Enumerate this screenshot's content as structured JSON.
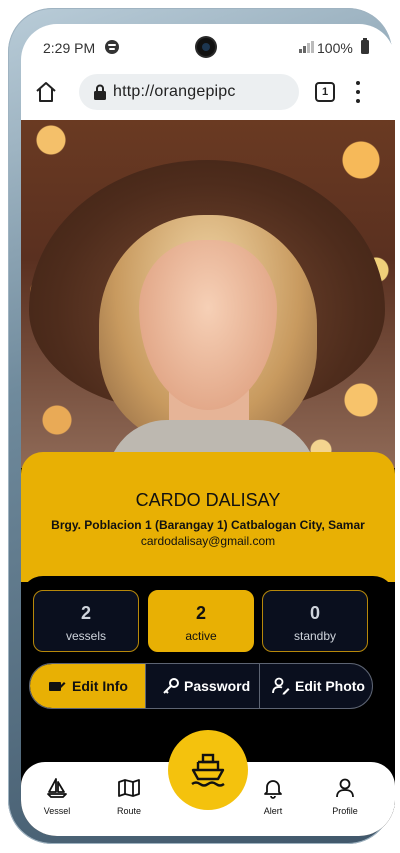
{
  "status_bar": {
    "time": "2:29 PM",
    "battery": "100%"
  },
  "browser": {
    "url": "http://orangepipc",
    "tab_count": "1"
  },
  "profile": {
    "name": "CARDO DALISAY",
    "address": "Brgy. Poblacion 1 (Barangay 1) Catbalogan City, Samar",
    "email": "cardodalisay@gmail.com"
  },
  "stats": [
    {
      "value": "2",
      "label": "vessels"
    },
    {
      "value": "2",
      "label": "active"
    },
    {
      "value": "0",
      "label": "standby"
    }
  ],
  "actions": {
    "edit_info": "Edit Info",
    "password": "Password",
    "edit_photo": "Edit Photo"
  },
  "nav": {
    "vessel": "Vessel",
    "route": "Route",
    "alert": "Alert",
    "profile": "Profile"
  },
  "colors": {
    "accent": "#e8b004",
    "fab": "#f4c20d",
    "panel": "#000000",
    "card_dark": "#0a0f1e"
  },
  "icons": {
    "home": "home-icon",
    "lock": "lock-icon",
    "tabs": "tabs-icon",
    "menu": "more-vert-icon",
    "center": "ship-icon"
  }
}
